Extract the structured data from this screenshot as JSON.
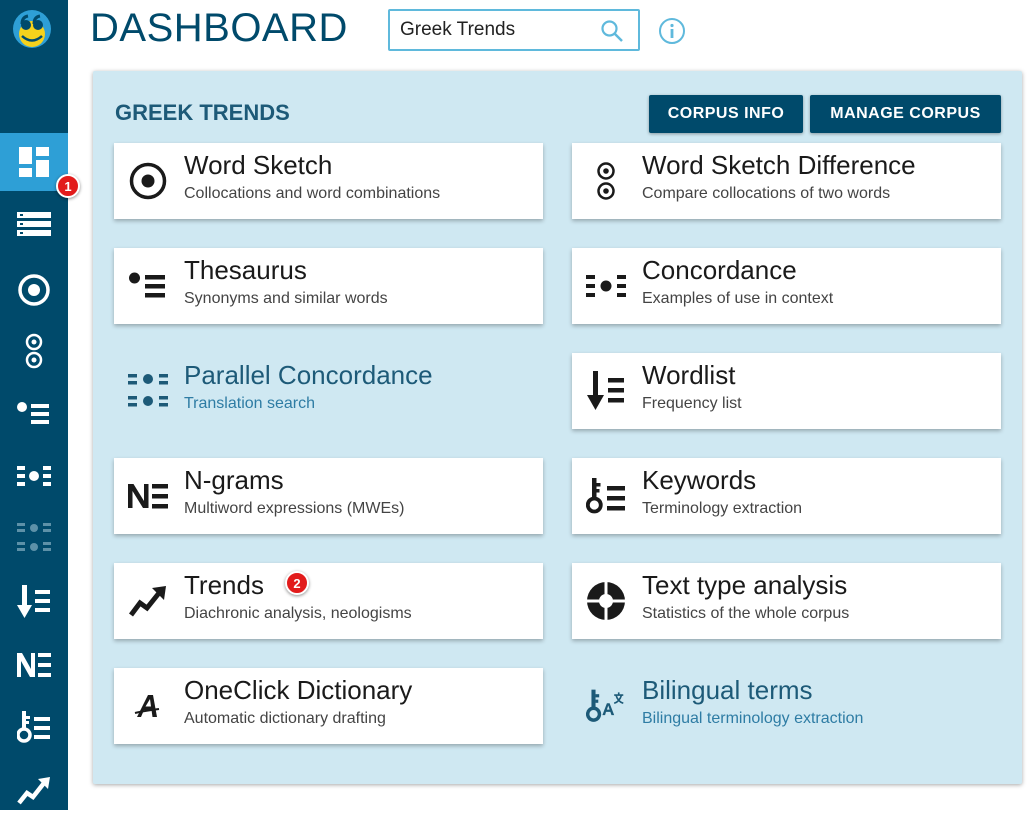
{
  "header": {
    "title": "DASHBOARD",
    "search_value": "Greek Trends"
  },
  "panel": {
    "title": "GREEK TRENDS",
    "buttons": {
      "corpus_info": "CORPUS INFO",
      "manage_corpus": "MANAGE CORPUS"
    }
  },
  "badges": [
    "1",
    "2"
  ],
  "sidebar": {
    "items": [
      {
        "name": "dashboard",
        "icon": "dashboard-icon",
        "active": true
      },
      {
        "name": "corpus-list",
        "icon": "list-icon"
      },
      {
        "name": "word-sketch",
        "icon": "word-sketch-icon"
      },
      {
        "name": "word-sketch-difference",
        "icon": "word-sketch-difference-icon"
      },
      {
        "name": "thesaurus",
        "icon": "thesaurus-icon"
      },
      {
        "name": "concordance",
        "icon": "concordance-icon"
      },
      {
        "name": "parallel-concordance",
        "icon": "parallel-concordance-icon",
        "disabled": true
      },
      {
        "name": "wordlist",
        "icon": "wordlist-icon"
      },
      {
        "name": "ngrams",
        "icon": "ngrams-icon"
      },
      {
        "name": "keywords",
        "icon": "keywords-icon"
      },
      {
        "name": "trends",
        "icon": "trends-icon"
      }
    ]
  },
  "cards": [
    {
      "title": "Word Sketch",
      "subtitle": "Collocations and word combinations",
      "icon": "word-sketch-icon"
    },
    {
      "title": "Word Sketch Difference",
      "subtitle": "Compare collocations of two words",
      "icon": "word-sketch-difference-icon"
    },
    {
      "title": "Thesaurus",
      "subtitle": "Synonyms and similar words",
      "icon": "thesaurus-icon"
    },
    {
      "title": "Concordance",
      "subtitle": "Examples of use in context",
      "icon": "concordance-icon"
    },
    {
      "title": "Parallel Concordance",
      "subtitle": "Translation search",
      "icon": "parallel-concordance-icon",
      "unavailable": true
    },
    {
      "title": "Wordlist",
      "subtitle": "Frequency list",
      "icon": "wordlist-icon"
    },
    {
      "title": "N-grams",
      "subtitle": "Multiword expressions (MWEs)",
      "icon": "ngrams-icon"
    },
    {
      "title": "Keywords",
      "subtitle": "Terminology extraction",
      "icon": "keywords-icon"
    },
    {
      "title": "Trends",
      "subtitle": "Diachronic analysis, neologisms",
      "icon": "trends-icon"
    },
    {
      "title": "Text type analysis",
      "subtitle": "Statistics of the whole corpus",
      "icon": "text-type-analysis-icon"
    },
    {
      "title": "OneClick Dictionary",
      "subtitle": "Automatic dictionary drafting",
      "icon": "oneclick-dictionary-icon"
    },
    {
      "title": "Bilingual terms",
      "subtitle": "Bilingual terminology extraction",
      "icon": "bilingual-terms-icon",
      "unavailable": true
    }
  ],
  "colors": {
    "sidebar": "#004a6b",
    "sidebar_active": "#2e9fd6",
    "panel_bg": "#cfe8f2",
    "accent": "#004a6b",
    "badge": "#e21b1b"
  }
}
